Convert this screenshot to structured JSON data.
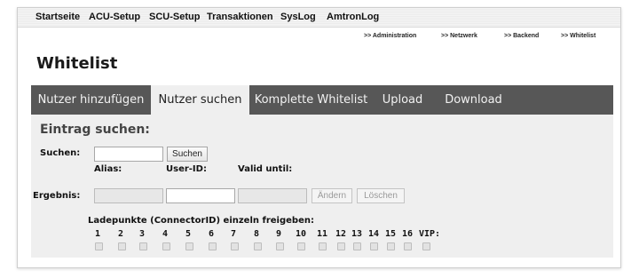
{
  "topnav": {
    "items": [
      "Startseite",
      "ACU-Setup",
      "SCU-Setup",
      "Transaktionen",
      "SysLog",
      "AmtronLog"
    ]
  },
  "subnav": {
    "items": [
      ">> Administration",
      ">> Netzwerk",
      ">> Backend",
      ">> Whitelist"
    ]
  },
  "page": {
    "title": "Whitelist"
  },
  "tabs": {
    "items": [
      "Nutzer hinzufügen",
      "Nutzer suchen",
      "Komplette Whitelist",
      "Upload",
      "Download"
    ],
    "active": "Nutzer suchen"
  },
  "search": {
    "section_title": "Eintrag suchen:",
    "label": "Suchen:",
    "value": "",
    "button": "Suchen"
  },
  "result": {
    "label": "Ergebnis:",
    "alias_header": "Alias:",
    "userid_header": "User-ID:",
    "valid_header": "Valid until:",
    "alias_value": "",
    "userid_value": "",
    "valid_value": "",
    "change_button": "Ändern",
    "delete_button": "Löschen"
  },
  "connectors": {
    "heading": "Ladepunkte (ConnectorID) einzeln freigeben:",
    "labels": [
      "1",
      "2",
      "3",
      "4",
      "5",
      "6",
      "7",
      "8",
      "9",
      "10",
      "11",
      "12",
      "13",
      "14",
      "15",
      "16",
      "VIP:"
    ],
    "checked": [
      false,
      false,
      false,
      false,
      false,
      false,
      false,
      false,
      false,
      false,
      false,
      false,
      false,
      false,
      false,
      false,
      false
    ]
  },
  "colors": {
    "tabbar": "#575757",
    "panel": "#efefef",
    "active_tab": "#efefef"
  }
}
